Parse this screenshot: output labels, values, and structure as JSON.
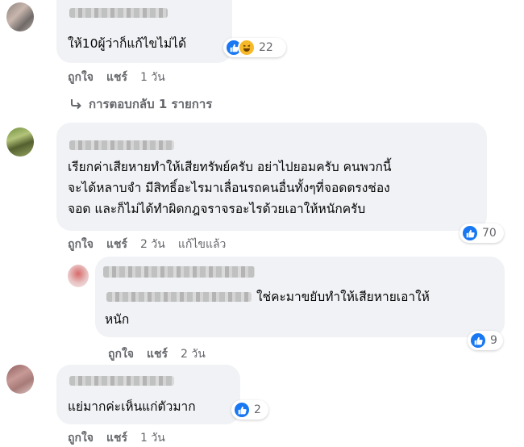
{
  "comments": [
    {
      "text": "ให้10ผู้ว่าก็แก้ไขไม่ได้",
      "reaction_count": "22",
      "actions": {
        "like": "ถูกใจ",
        "share": "แชร์",
        "time": "1 วัน"
      },
      "reply_link": "การตอบกลับ 1 รายการ"
    },
    {
      "text": "เรียกค่าเสียหายทำให้เสียทรัพย์ครับ อย่าไปยอมครับ คนพวกนี้\nจะได้หลาบจำ มีสิทธิ์อะไรมาเลื่อนรถคนอื่นทั้งๆที่จอดตรงช่อง\nจอด และก็ไม่ได้ทำผิดกฎจราจรอะไรด้วยเอาให้หนักครับ",
      "reaction_count": "70",
      "actions": {
        "like": "ถูกใจ",
        "share": "แชร์",
        "time": "2 วัน",
        "edited": "แก้ไขแล้ว"
      }
    },
    {
      "text_line1": "ใช่คะมาขยับทำให้เสียหายเอาให้",
      "text_line2": "หนัก",
      "reaction_count": "9",
      "actions": {
        "like": "ถูกใจ",
        "share": "แชร์",
        "time": "2 วัน"
      }
    },
    {
      "text": "แย่มากค่ะเห็นแก่ตัวมาก",
      "reaction_count": "2",
      "actions": {
        "like": "ถูกใจ",
        "share": "แชร์",
        "time": "1 วัน"
      }
    }
  ],
  "colors": {
    "like_blue": "#1877f2",
    "haha_yellow": "#f7b928",
    "bubble_bg": "#f0f2f5",
    "meta_gray": "#65676b"
  }
}
